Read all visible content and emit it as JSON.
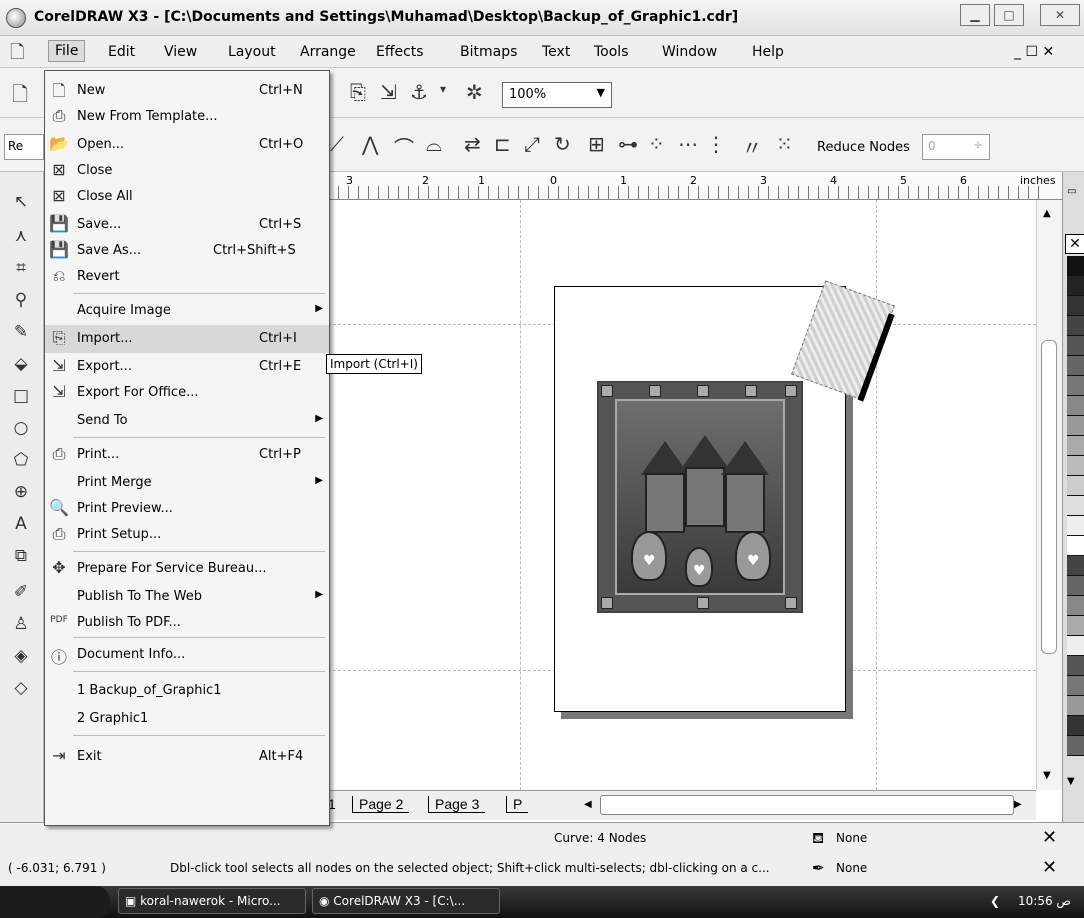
{
  "window": {
    "title": "CorelDRAW X3 - [C:\\Documents and Settings\\Muhamad\\Desktop\\Backup_of_Graphic1.cdr]",
    "minimize": "▁",
    "maximize": "□",
    "close": "✕"
  },
  "menubar": {
    "items": [
      "File",
      "Edit",
      "View",
      "Layout",
      "Arrange",
      "Effects",
      "Bitmaps",
      "Text",
      "Tools",
      "Window",
      "Help"
    ],
    "doc_controls": "_ ☐ ✕"
  },
  "toolbar": {
    "zoom": "100%",
    "reduce_nodes_label": "Reduce Nodes",
    "reduce_nodes_value": "0",
    "left_combo": "Re"
  },
  "ruler": {
    "units": "inches",
    "labels": [
      "3",
      "2",
      "1",
      "0",
      "1",
      "2",
      "3",
      "4",
      "5",
      "6"
    ]
  },
  "file_menu": {
    "items": [
      {
        "icon": "new-icon",
        "label": "New",
        "shortcut": "Ctrl+N"
      },
      {
        "icon": "template-icon",
        "label": "New From Template...",
        "shortcut": ""
      },
      {
        "icon": "open-icon",
        "label": "Open...",
        "shortcut": "Ctrl+O"
      },
      {
        "icon": "close-doc-icon",
        "label": "Close",
        "shortcut": ""
      },
      {
        "icon": "close-all-icon",
        "label": "Close All",
        "shortcut": ""
      },
      {
        "icon": "save-icon",
        "label": "Save...",
        "shortcut": "Ctrl+S"
      },
      {
        "icon": "save-as-icon",
        "label": "Save As...",
        "shortcut": "Ctrl+Shift+S"
      },
      {
        "icon": "revert-icon",
        "label": "Revert",
        "shortcut": ""
      },
      {
        "icon": "",
        "label": "Acquire Image",
        "shortcut": "",
        "submenu": true
      },
      {
        "icon": "import-icon",
        "label": "Import...",
        "shortcut": "Ctrl+I",
        "highlighted": true
      },
      {
        "icon": "export-icon",
        "label": "Export...",
        "shortcut": "Ctrl+E"
      },
      {
        "icon": "export-office-icon",
        "label": "Export For Office...",
        "shortcut": ""
      },
      {
        "icon": "",
        "label": "Send To",
        "shortcut": "",
        "submenu": true
      },
      {
        "icon": "print-icon",
        "label": "Print...",
        "shortcut": "Ctrl+P"
      },
      {
        "icon": "",
        "label": "Print Merge",
        "shortcut": "",
        "submenu": true
      },
      {
        "icon": "print-preview-icon",
        "label": "Print Preview...",
        "shortcut": ""
      },
      {
        "icon": "print-setup-icon",
        "label": "Print Setup...",
        "shortcut": ""
      },
      {
        "icon": "service-bureau-icon",
        "label": "Prepare For Service Bureau...",
        "shortcut": ""
      },
      {
        "icon": "",
        "label": "Publish To The Web",
        "shortcut": "",
        "submenu": true
      },
      {
        "icon": "pdf-icon",
        "label": "Publish To PDF...",
        "shortcut": ""
      },
      {
        "icon": "info-icon",
        "label": "Document Info...",
        "shortcut": ""
      },
      {
        "icon": "",
        "label": "1 Backup_of_Graphic1",
        "shortcut": ""
      },
      {
        "icon": "",
        "label": "2 Graphic1",
        "shortcut": ""
      },
      {
        "icon": "exit-icon",
        "label": "Exit",
        "shortcut": "Alt+F4"
      }
    ]
  },
  "tooltip": "Import (Ctrl+I)",
  "page_tabs": [
    "1",
    "Page 2",
    "Page 3",
    "P"
  ],
  "status": {
    "object_info": "Curve: 4 Nodes",
    "coords": "( -6.031; 6.791 )",
    "hint": "Dbl-click tool selects all nodes on the selected object; Shift+click multi-selects; dbl-clicking on a c...",
    "fill": "None",
    "outline": "None"
  },
  "taskbar": {
    "buttons": [
      "koral-nawerok - Micro...",
      "CorelDRAW X3 - [C:\\..."
    ],
    "clock": "10:56 ص",
    "arrow": "❮"
  }
}
